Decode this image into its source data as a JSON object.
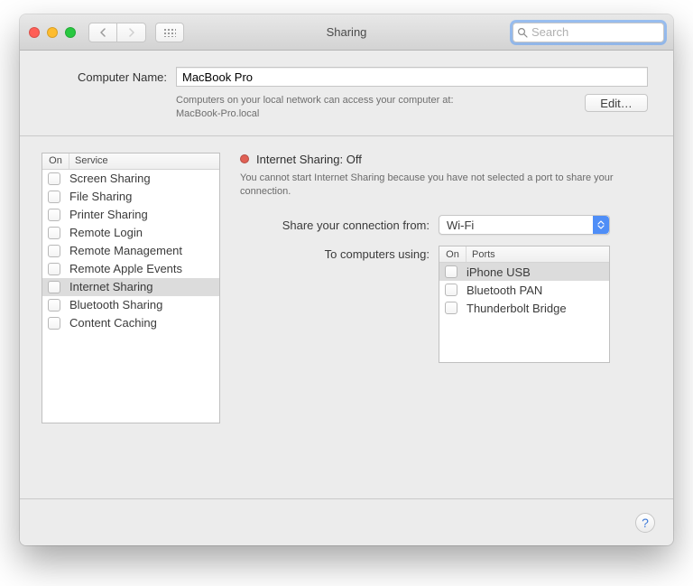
{
  "window": {
    "title": "Sharing"
  },
  "toolbar": {
    "search_placeholder": "Search"
  },
  "computer": {
    "label": "Computer Name:",
    "value": "MacBook Pro",
    "hint_line1": "Computers on your local network can access your computer at:",
    "hint_line2": "MacBook-Pro.local",
    "edit_label": "Edit…"
  },
  "services": {
    "header_on": "On",
    "header_service": "Service",
    "items": [
      {
        "label": "Screen Sharing",
        "selected": false
      },
      {
        "label": "File Sharing",
        "selected": false
      },
      {
        "label": "Printer Sharing",
        "selected": false
      },
      {
        "label": "Remote Login",
        "selected": false
      },
      {
        "label": "Remote Management",
        "selected": false
      },
      {
        "label": "Remote Apple Events",
        "selected": false
      },
      {
        "label": "Internet Sharing",
        "selected": true
      },
      {
        "label": "Bluetooth Sharing",
        "selected": false
      },
      {
        "label": "Content Caching",
        "selected": false
      }
    ]
  },
  "detail": {
    "status_color": "#e06054",
    "title": "Internet Sharing: Off",
    "message": "You cannot start Internet Sharing because you have not selected a port to share your connection.",
    "share_from_label": "Share your connection from:",
    "share_from_value": "Wi-Fi",
    "to_label": "To computers using:",
    "ports_header_on": "On",
    "ports_header_ports": "Ports",
    "ports": [
      {
        "label": "iPhone USB",
        "selected": true
      },
      {
        "label": "Bluetooth PAN",
        "selected": false
      },
      {
        "label": "Thunderbolt Bridge",
        "selected": false
      }
    ]
  },
  "footer": {
    "help": "?"
  }
}
